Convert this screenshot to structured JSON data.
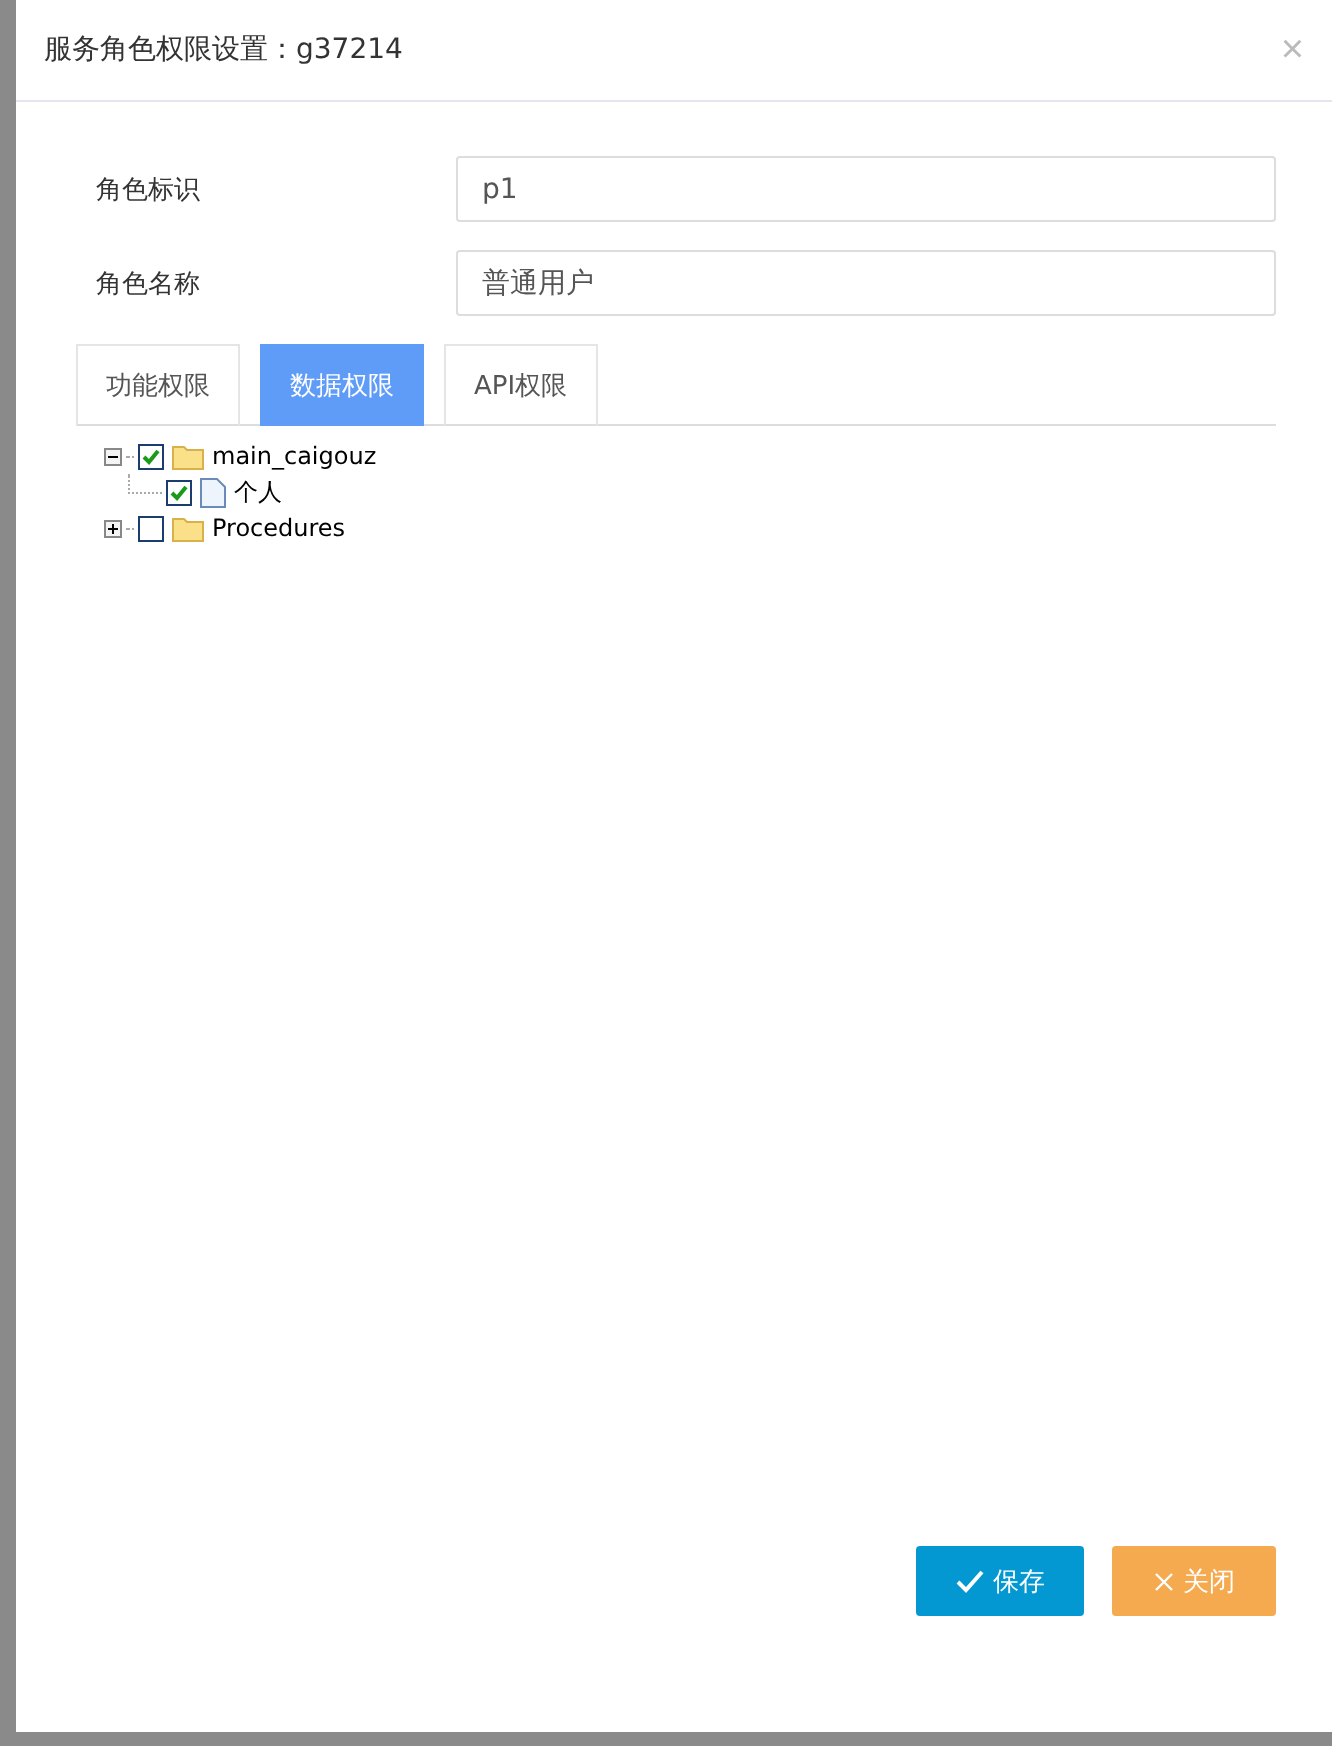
{
  "dialog": {
    "title": "服务角色权限设置：g37214",
    "close": "×"
  },
  "fields": [
    {
      "label": "角色标识",
      "value": "p1"
    },
    {
      "label": "角色名称",
      "value": "普通用户"
    }
  ],
  "tabs": [
    {
      "label": "功能权限",
      "selected": false
    },
    {
      "label": "数据权限",
      "selected": true
    },
    {
      "label": "API权限",
      "selected": false
    }
  ],
  "tree": [
    {
      "label": "main_caigouz",
      "kind": "folder",
      "checked": true,
      "expanded": true,
      "children": [
        {
          "label": "个人",
          "kind": "file",
          "checked": true
        }
      ]
    },
    {
      "label": "Procedures",
      "kind": "folder",
      "checked": false,
      "expanded": false
    }
  ],
  "buttons": [
    {
      "label": "保存",
      "kind": "save"
    },
    {
      "label": "关闭",
      "kind": "close"
    }
  ]
}
